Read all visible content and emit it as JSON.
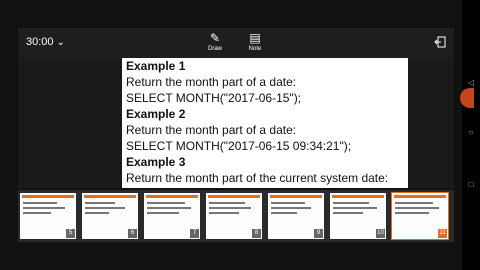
{
  "status": {
    "time": "30:00"
  },
  "tools": [
    {
      "label": "Draw"
    },
    {
      "label": "Note"
    }
  ],
  "slide": {
    "lines": [
      {
        "text": "Example 1",
        "heading": true
      },
      {
        "text": "Return the month part of a date:",
        "heading": false
      },
      {
        "text": "SELECT MONTH(\"2017-06-15\");",
        "heading": false
      },
      {
        "text": "Example 2",
        "heading": true
      },
      {
        "text": "Return the month part of a date:",
        "heading": false
      },
      {
        "text": "SELECT MONTH(\"2017-06-15 09:34:21\");",
        "heading": false
      },
      {
        "text": "Example 3",
        "heading": true
      },
      {
        "text": "Return the month part of the current system date:",
        "heading": false
      }
    ]
  },
  "thumbnails": [
    {
      "number": "5"
    },
    {
      "number": "6"
    },
    {
      "number": "7"
    },
    {
      "number": "8"
    },
    {
      "number": "9"
    },
    {
      "number": "10"
    },
    {
      "number": "11",
      "active": true
    }
  ],
  "colors": {
    "accent": "#e07020"
  }
}
